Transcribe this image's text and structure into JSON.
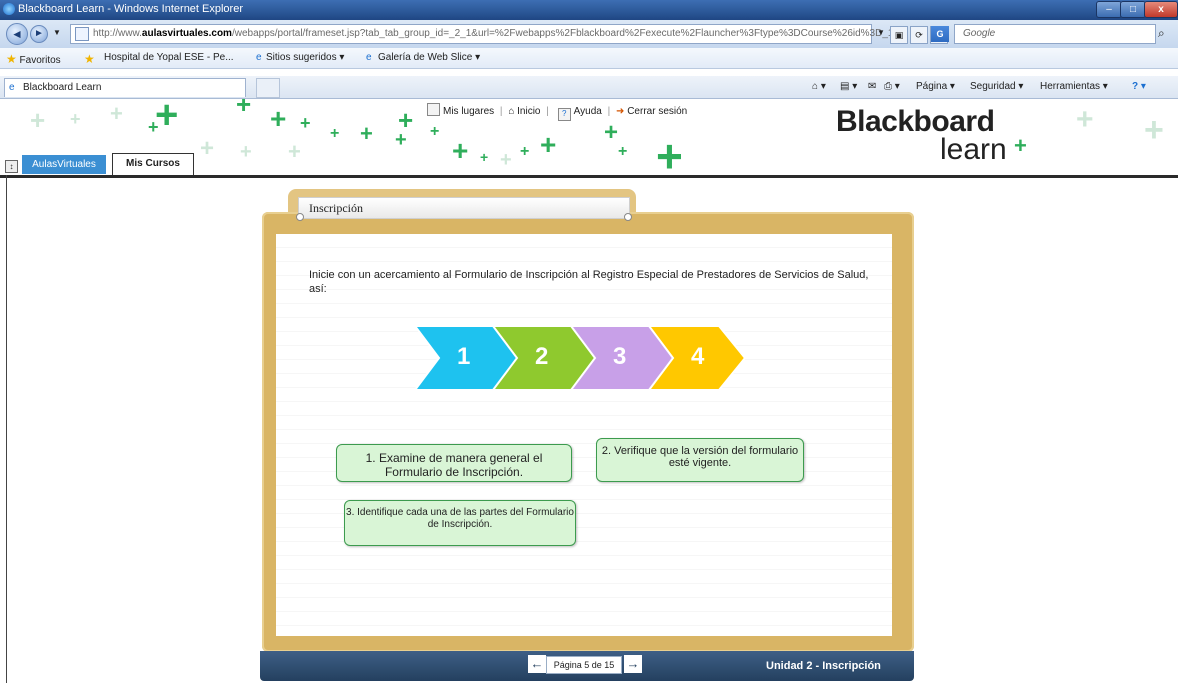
{
  "window": {
    "title": "Blackboard Learn - Windows Internet Explorer",
    "min": "–",
    "max": "□",
    "close": "x"
  },
  "navbar": {
    "url_prefix": "http://www.",
    "url_domain": "aulasvirtuales.com",
    "url_rest": "/webapps/portal/frameset.jsp?tab_tab_group_id=_2_1&url=%2Fwebapps%2Fblackboard%2Fexecute%2Flauncher%3Ftype%3DCourse%26id%3D_1",
    "search_placeholder": "Google"
  },
  "favorites": {
    "favoritos": "Favoritos",
    "hospital": "Hospital de Yopal ESE - Pe...",
    "sitios": "Sitios sugeridos ▾",
    "galeria": "Galería de Web Slice ▾"
  },
  "tabs": {
    "active": "Blackboard Learn"
  },
  "commands": {
    "pagina": "Página ▾",
    "seguridad": "Seguridad ▾",
    "herramientas": "Herramientas ▾"
  },
  "header": {
    "mis_lugares": "Mis lugares",
    "inicio": "Inicio",
    "ayuda": "Ayuda",
    "cerrar": "Cerrar sesión",
    "logo_top": "Blackboard",
    "logo_bottom": "learn",
    "tab_aulas": "AulasVirtuales",
    "tab_mis": "Mis Cursos"
  },
  "content": {
    "section_title": "Inscripción",
    "intro": "Inicie con un acercamiento al Formulario de Inscripción al Registro Especial de Prestadores de Servicios de Salud, así:",
    "steps": [
      {
        "label": "1",
        "color": "#1ec2ef"
      },
      {
        "label": "2",
        "color": "#8fc92e"
      },
      {
        "label": "3",
        "color": "#c8a0e8"
      },
      {
        "label": "4",
        "color": "#ffc800"
      }
    ],
    "notes": [
      "1. Examine de manera general el Formulario de Inscripción.",
      "2. Verifique que la versión del formulario esté vigente.",
      "3. Identifique cada una de las partes del Formulario de Inscripción."
    ]
  },
  "footer": {
    "page": "Página 5 de 15",
    "unit": "Unidad 2 - Inscripción",
    "prev": "←",
    "next": "→"
  }
}
